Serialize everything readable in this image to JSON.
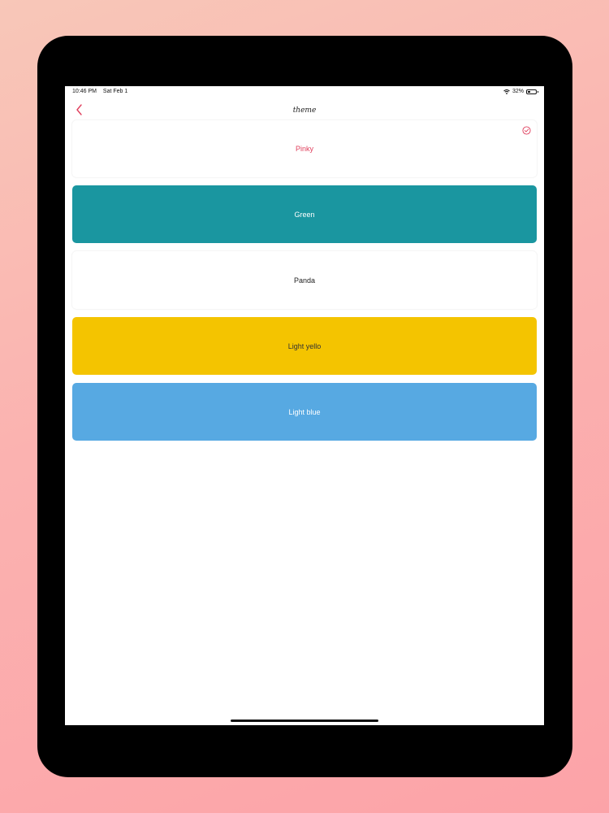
{
  "status_bar": {
    "time": "10:46 PM",
    "date": "Sat Feb 1",
    "battery": "32%"
  },
  "nav": {
    "title": "theme"
  },
  "themes": [
    {
      "label": "Pinky",
      "bg": "#ffffff",
      "text_color": "#e0405e",
      "selected": true
    },
    {
      "label": "Green",
      "bg": "#1a96a0",
      "text_color": "#ffffff",
      "selected": false
    },
    {
      "label": "Panda",
      "bg": "#ffffff",
      "text_color": "#222222",
      "selected": false
    },
    {
      "label": "Light yello",
      "bg": "#f4c400",
      "text_color": "#333333",
      "selected": false
    },
    {
      "label": "Light blue",
      "bg": "#57a9e2",
      "text_color": "#ffffff",
      "selected": false
    }
  ],
  "colors": {
    "accent": "#e0405e",
    "background": "#ffffff",
    "device_frame": "#000000"
  }
}
